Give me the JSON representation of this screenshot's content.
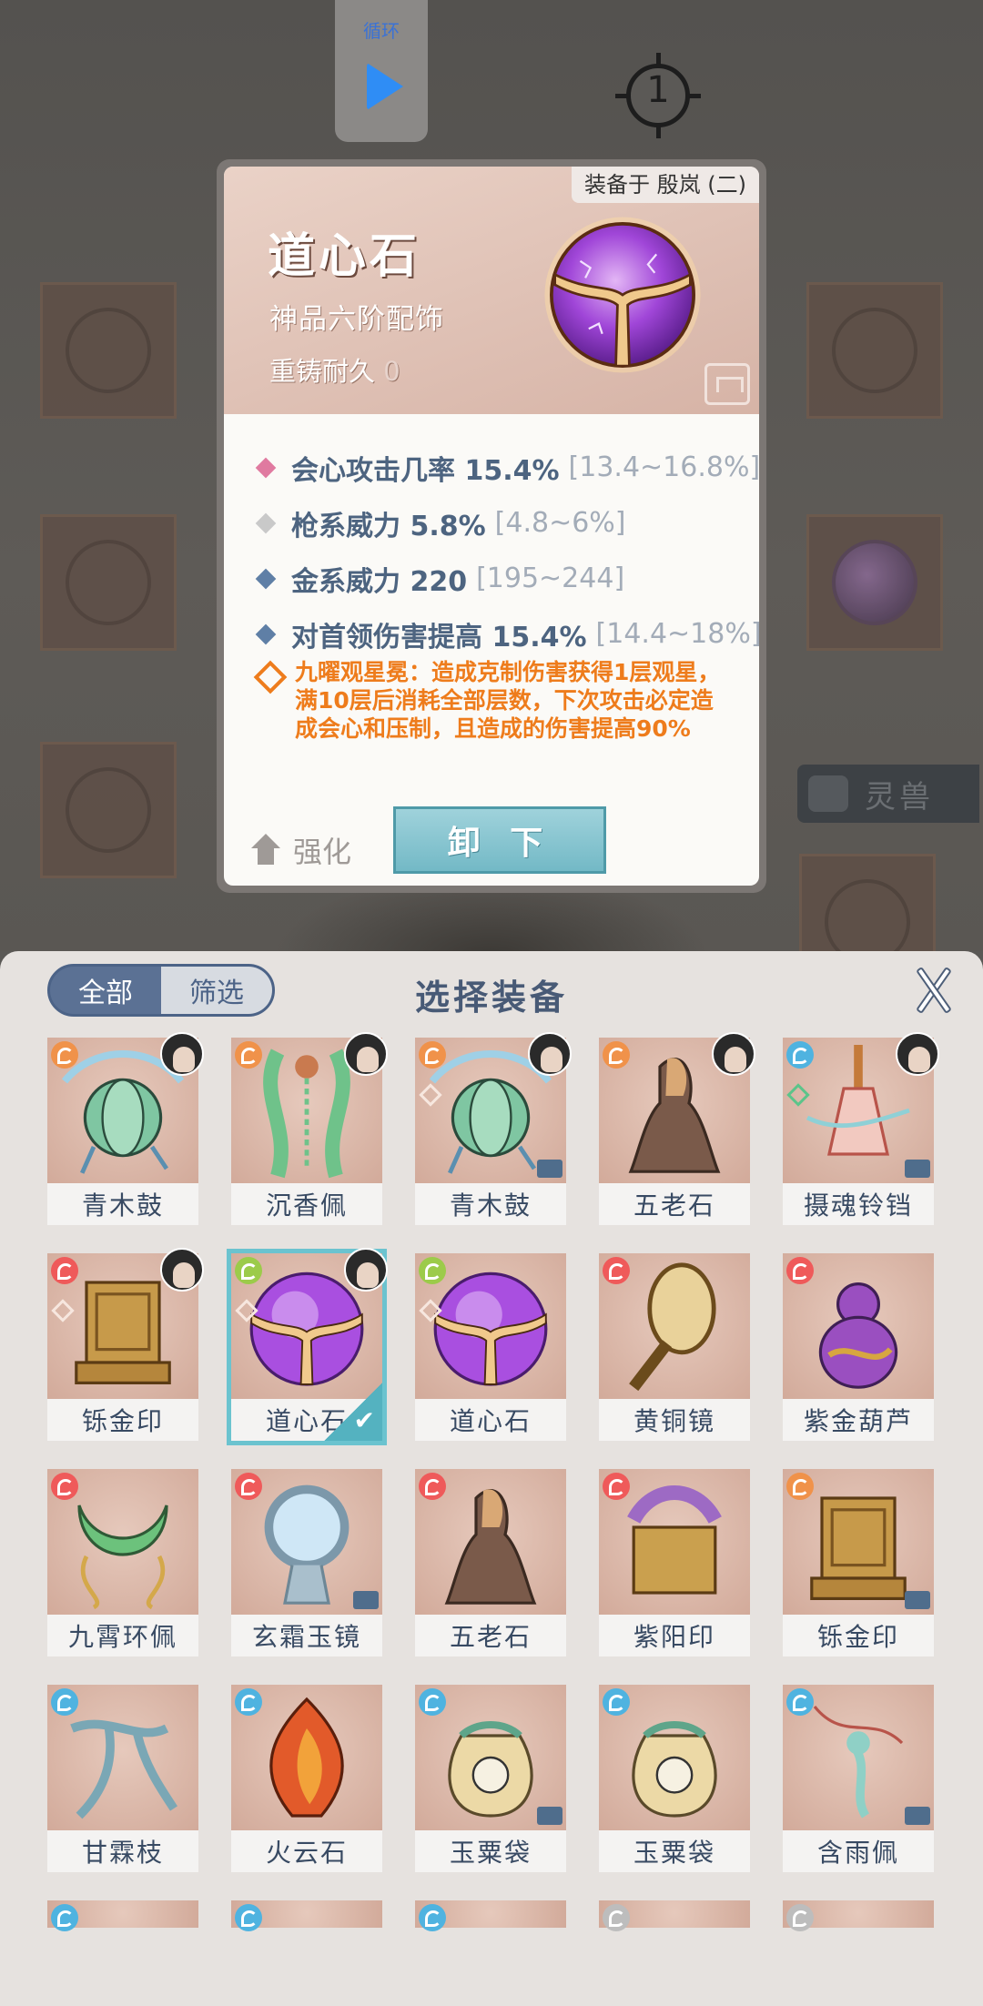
{
  "hud": {
    "loop_label": "循环",
    "target_number": "1"
  },
  "background": {
    "spirit_beast_tab": "灵兽"
  },
  "tooltip": {
    "equipped_on": "装备于 殷岚 (二)",
    "name": "道心石",
    "grade": "神品六阶配饰",
    "reforge_label": "重铸耐久",
    "reforge_value": "0",
    "stats": [
      {
        "name": "会心攻击几率 15.4%",
        "range": "[13.4~16.8%]",
        "color": "#e07aa0"
      },
      {
        "name": "枪系威力 5.8%",
        "range": "[4.8~6%]",
        "color": "#c9c9c9"
      },
      {
        "name": "金系威力 220",
        "range": "[195~244]",
        "color": "#5f7fa6"
      },
      {
        "name": "对首领伤害提高 15.4%",
        "range": "[14.4~18%]",
        "color": "#5f7fa6"
      }
    ],
    "effect_line1": "九曜观星冕：造成克制伤害获得1层观星，",
    "effect_line2": "满10层后消耗全部层数，下次攻击必定造",
    "effect_line3": "成会心和压制，且造成的伤害提高90%",
    "effect_color": "#ee7c1c",
    "upgrade_label": "强化",
    "unequip_label": "卸 下"
  },
  "panel": {
    "tab_all": "全部",
    "tab_filter": "筛选",
    "title": "选择装备",
    "items": [
      {
        "label": "青木鼓",
        "element": "#f0924a",
        "avatar": true,
        "chest": false,
        "mark": false,
        "art": "drum"
      },
      {
        "label": "沉香佩",
        "element": "#f0924a",
        "avatar": true,
        "chest": false,
        "mark": false,
        "art": "jade"
      },
      {
        "label": "青木鼓",
        "element": "#f0924a",
        "avatar": true,
        "chest": true,
        "mark": true,
        "art": "drum"
      },
      {
        "label": "五老石",
        "element": "#f0924a",
        "avatar": true,
        "chest": false,
        "mark": false,
        "art": "stone"
      },
      {
        "label": "摄魂铃铛",
        "element": "#4fb3e0",
        "avatar": true,
        "chest": true,
        "mark": true,
        "mark_green": true,
        "art": "bell"
      },
      {
        "label": "铄金印",
        "element": "#ef5a5a",
        "avatar": true,
        "chest": false,
        "mark": true,
        "art": "seal"
      },
      {
        "label": "道心石",
        "element": "#9ccb4a",
        "avatar": true,
        "chest": false,
        "mark": true,
        "art": "orb",
        "selected": true
      },
      {
        "label": "道心石",
        "element": "#9ccb4a",
        "avatar": false,
        "chest": false,
        "mark": true,
        "art": "orb"
      },
      {
        "label": "黄铜镜",
        "element": "#ef5a5a",
        "avatar": false,
        "chest": false,
        "mark": false,
        "art": "mirror"
      },
      {
        "label": "紫金葫芦",
        "element": "#ef5a5a",
        "avatar": false,
        "chest": false,
        "mark": false,
        "art": "gourd"
      },
      {
        "label": "九霄环佩",
        "element": "#ef5a5a",
        "avatar": false,
        "chest": false,
        "mark": false,
        "art": "ring"
      },
      {
        "label": "玄霜玉镜",
        "element": "#ef5a5a",
        "avatar": false,
        "chest": true,
        "mark": false,
        "art": "frostmirror"
      },
      {
        "label": "五老石",
        "element": "#ef5a5a",
        "avatar": false,
        "chest": false,
        "mark": false,
        "art": "stone"
      },
      {
        "label": "紫阳印",
        "element": "#ef5a5a",
        "avatar": false,
        "chest": false,
        "mark": false,
        "art": "purpleseal"
      },
      {
        "label": "铄金印",
        "element": "#f0924a",
        "avatar": false,
        "chest": true,
        "mark": false,
        "art": "seal"
      },
      {
        "label": "甘霖枝",
        "element": "#4fb3e0",
        "avatar": false,
        "chest": false,
        "mark": false,
        "art": "branch"
      },
      {
        "label": "火云石",
        "element": "#4fb3e0",
        "avatar": false,
        "chest": false,
        "mark": false,
        "art": "fire"
      },
      {
        "label": "玉粟袋",
        "element": "#4fb3e0",
        "avatar": false,
        "chest": true,
        "mark": false,
        "art": "bag"
      },
      {
        "label": "玉粟袋",
        "element": "#4fb3e0",
        "avatar": false,
        "chest": false,
        "mark": false,
        "art": "bag"
      },
      {
        "label": "含雨佩",
        "element": "#4fb3e0",
        "avatar": false,
        "chest": true,
        "mark": false,
        "art": "pendant"
      }
    ],
    "partial_row_elements": [
      "#4fb3e0",
      "#4fb3e0",
      "#4fb3e0",
      "#bdbdbd",
      "#bdbdbd"
    ]
  }
}
